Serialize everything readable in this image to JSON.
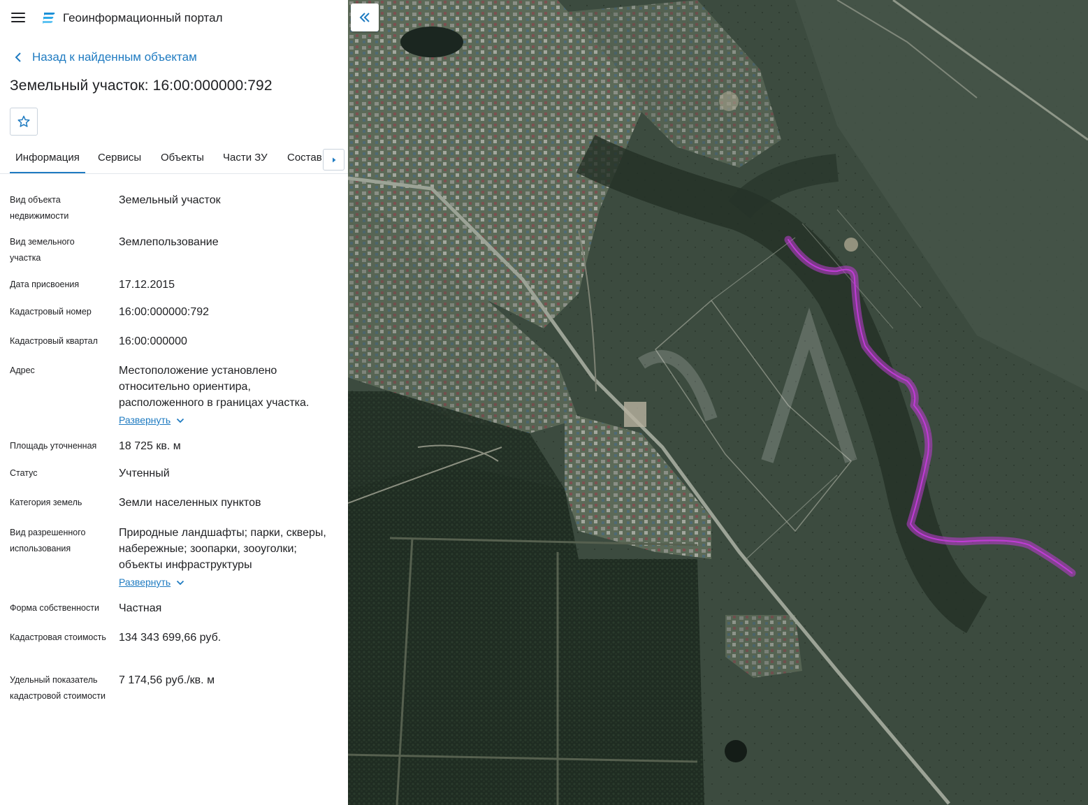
{
  "header": {
    "portal_title": "Геоинформационный портал"
  },
  "nav": {
    "back_label": "Назад к найденным объектам"
  },
  "object": {
    "title": "Земельный участок: 16:00:000000:792"
  },
  "tabs": [
    {
      "label": "Информация",
      "active": true
    },
    {
      "label": "Сервисы"
    },
    {
      "label": "Объекты"
    },
    {
      "label": "Части ЗУ"
    },
    {
      "label": "Состав"
    }
  ],
  "expand_label": "Развернуть",
  "info": [
    {
      "label": "Вид объекта недвижимости",
      "value": "Земельный участок"
    },
    {
      "label": "Вид земельного участка",
      "value": "Землепользование"
    },
    {
      "label": "Дата присвоения",
      "value": "17.12.2015"
    },
    {
      "label": "Кадастровый номер",
      "value": "16:00:000000:792"
    },
    {
      "label": "Кадастровый квартал",
      "value": "16:00:000000"
    },
    {
      "label": "Адрес",
      "value": "Местоположение установлено относительно ориентира, расположенного в границах участка."
    },
    {
      "label": "Площадь уточненная",
      "value": "18 725 кв. м"
    },
    {
      "label": "Статус",
      "value": "Учтенный"
    },
    {
      "label": "Категория земель",
      "value": "Земли населенных пунктов"
    },
    {
      "label": "Вид разрешенного использования",
      "value": "Природные ландшафты; парки, скверы, набережные; зоопарки, зооуголки; объекты инфраструктуры"
    },
    {
      "label": "Форма собственности",
      "value": "Частная"
    },
    {
      "label": "Кадастровая стоимость",
      "value": "134 343 699,66 руб."
    },
    {
      "label": "Удельный показатель кадастровой стоимости",
      "value": "7 174,56 руб./кв. м"
    }
  ],
  "map": {
    "parcel_color": "#c03cd6"
  }
}
